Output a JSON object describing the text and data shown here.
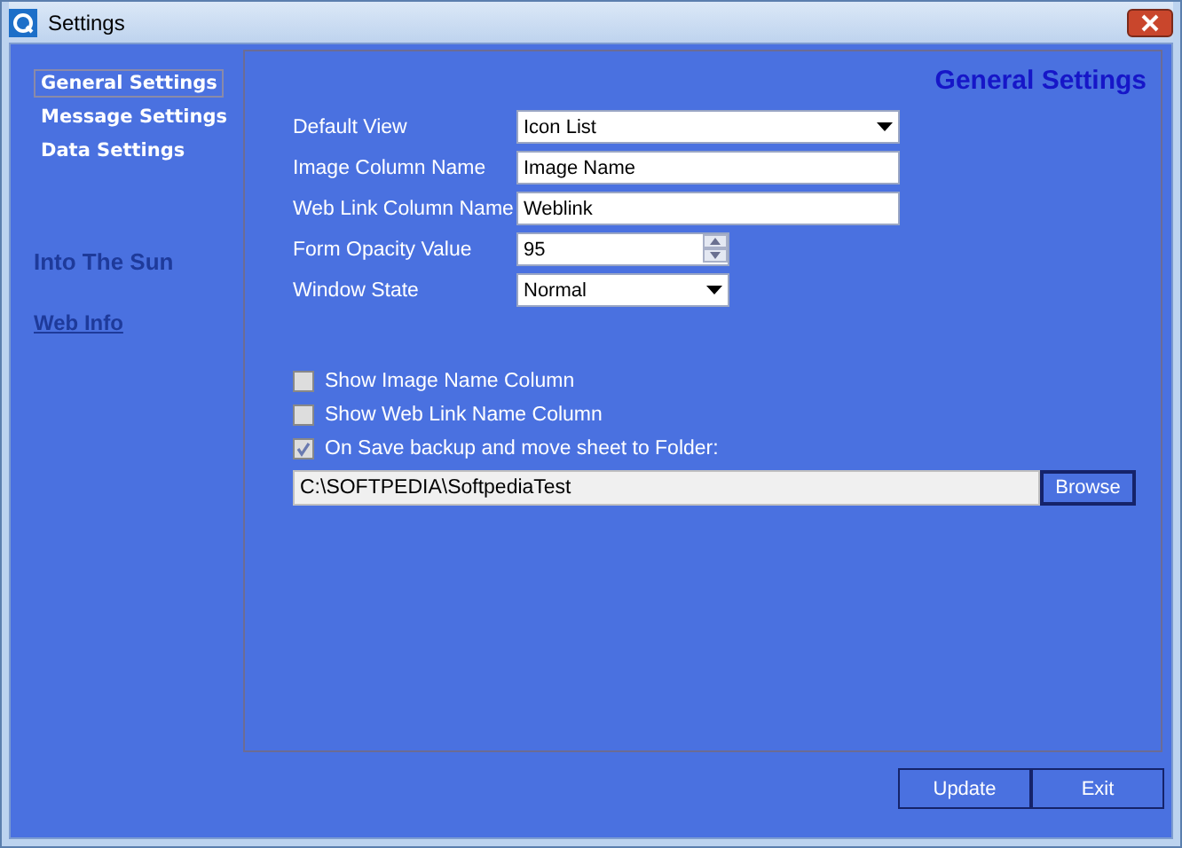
{
  "window": {
    "title": "Settings"
  },
  "sidebar": {
    "items": [
      {
        "label": "General Settings",
        "selected": true
      },
      {
        "label": "Message Settings",
        "selected": false
      },
      {
        "label": "Data Settings",
        "selected": false
      }
    ],
    "background_title": "Into The Sun",
    "background_link": "Web Info"
  },
  "panel": {
    "heading": "General Settings",
    "fields": [
      {
        "kind": "dropdown",
        "label": "Default View",
        "value": "Icon List"
      },
      {
        "kind": "text",
        "label": "Image Column Name",
        "value": "Image Name"
      },
      {
        "kind": "text",
        "label": "Web Link Column Name",
        "value": "Weblink"
      },
      {
        "kind": "spin",
        "label": "Form Opacity Value",
        "value": "95"
      },
      {
        "kind": "dropdown",
        "label": "Window State",
        "value": "Normal"
      }
    ],
    "checkboxes": [
      {
        "label": "Show Image Name Column",
        "checked": false
      },
      {
        "label": "Show Web Link Name Column",
        "checked": false
      },
      {
        "label": "On Save backup and move sheet to Folder:",
        "checked": true
      }
    ],
    "folder": {
      "value": "C:\\SOFTPEDIA\\SoftpediaTest",
      "button": "Browse"
    }
  },
  "buttons": [
    "Update",
    "Exit"
  ]
}
